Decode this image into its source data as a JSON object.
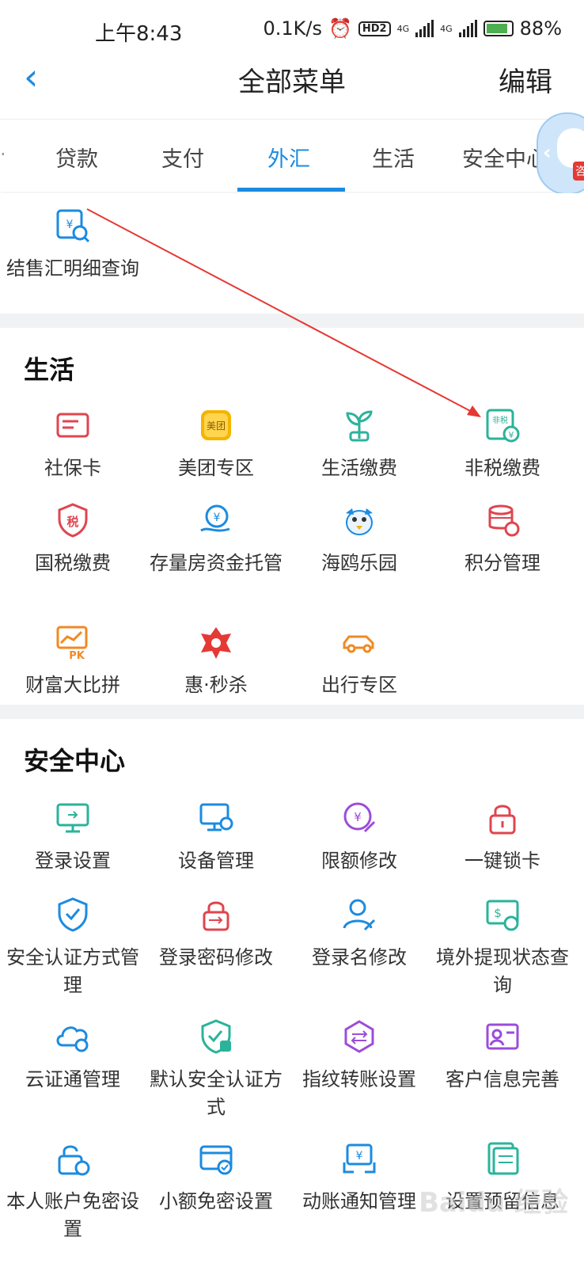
{
  "status_bar": {
    "time": "上午8:43",
    "speed": "0.1K/s",
    "hd": "HD2",
    "net1": "4G",
    "net2": "4G",
    "battery": "88%"
  },
  "nav": {
    "back_icon": "chevron-left-icon",
    "title": "全部菜单",
    "edit_label": "编辑"
  },
  "tabs": [
    {
      "label": "贷款",
      "active": false
    },
    {
      "label": "支付",
      "active": false
    },
    {
      "label": "外汇",
      "active": true
    },
    {
      "label": "生活",
      "active": false
    },
    {
      "label": "安全中心",
      "active": false
    }
  ],
  "mascot_badge": "咨",
  "forex": {
    "items": [
      {
        "label": "结售汇明细查询",
        "icon": "forex-query-icon",
        "color": "#1c8be0"
      }
    ]
  },
  "life": {
    "title": "生活",
    "items": [
      {
        "label": "社保卡",
        "icon": "social-card-icon",
        "color": "#e0454f"
      },
      {
        "label": "美团专区",
        "icon": "meituan-icon",
        "color": "#f4b400"
      },
      {
        "label": "生活缴费",
        "icon": "plant-icon",
        "color": "#2bb39a"
      },
      {
        "label": "非税缴费",
        "icon": "non-tax-icon",
        "color": "#2bb39a"
      },
      {
        "label": "国税缴费",
        "icon": "tax-shield-icon",
        "color": "#e0454f"
      },
      {
        "label": "存量房资金托管",
        "icon": "hand-money-icon",
        "color": "#1c8be0"
      },
      {
        "label": "海鸥乐园",
        "icon": "seagull-icon",
        "color": "#1c8be0"
      },
      {
        "label": "积分管理",
        "icon": "coin-stack-icon",
        "color": "#e0454f"
      },
      {
        "label": "财富大比拼",
        "icon": "pk-chart-icon",
        "color": "#f08a24"
      },
      {
        "label": "惠·秒杀",
        "icon": "flash-sale-icon",
        "color": "#e53935"
      },
      {
        "label": "出行专区",
        "icon": "car-icon",
        "color": "#f08a24"
      }
    ]
  },
  "security": {
    "title": "安全中心",
    "items": [
      {
        "label": "登录设置",
        "icon": "monitor-login-icon",
        "color": "#2bb39a"
      },
      {
        "label": "设备管理",
        "icon": "device-icon",
        "color": "#1c8be0"
      },
      {
        "label": "限额修改",
        "icon": "limit-edit-icon",
        "color": "#9c4dd8"
      },
      {
        "label": "一键锁卡",
        "icon": "lock-icon",
        "color": "#e0454f"
      },
      {
        "label": "安全认证方式管理",
        "icon": "shield-check-icon",
        "color": "#1c8be0"
      },
      {
        "label": "登录密码修改",
        "icon": "password-lock-icon",
        "color": "#e0454f"
      },
      {
        "label": "登录名修改",
        "icon": "user-edit-icon",
        "color": "#1c8be0"
      },
      {
        "label": "境外提现状态查询",
        "icon": "overseas-cash-icon",
        "color": "#2bb39a"
      },
      {
        "label": "云证通管理",
        "icon": "cloud-icon",
        "color": "#1c8be0"
      },
      {
        "label": "默认安全认证方式",
        "icon": "shield-default-icon",
        "color": "#2bb39a"
      },
      {
        "label": "指纹转账设置",
        "icon": "fingerprint-transfer-icon",
        "color": "#9c4dd8"
      },
      {
        "label": "客户信息完善",
        "icon": "id-card-icon",
        "color": "#9c4dd8"
      },
      {
        "label": "本人账户免密设置",
        "icon": "account-unlock-icon",
        "color": "#1c8be0"
      },
      {
        "label": "小额免密设置",
        "icon": "small-pay-card-icon",
        "color": "#1c8be0"
      },
      {
        "label": "动账通知管理",
        "icon": "notify-icon",
        "color": "#1c8be0"
      },
      {
        "label": "设置预留信息",
        "icon": "reserved-info-icon",
        "color": "#2bb39a"
      }
    ]
  },
  "watermark": "Baidu 经验"
}
